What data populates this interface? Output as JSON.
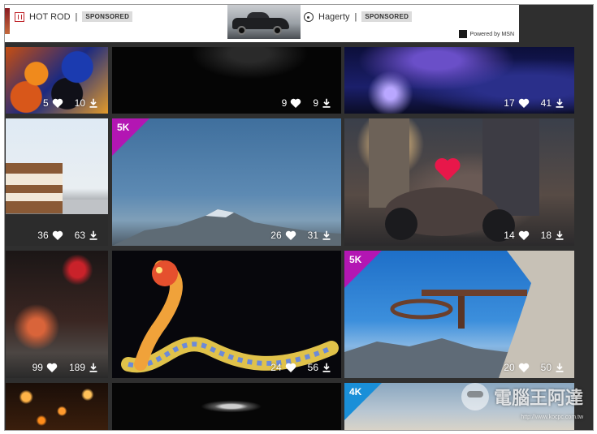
{
  "ads": {
    "ad1": {
      "brand": "HOT ROD",
      "separator": "|",
      "badge": "SPONSORED"
    },
    "ad2": {
      "brand": "Hagerty",
      "separator": "|",
      "badge": "SPONSORED"
    },
    "powered_by": "Powered by MSN"
  },
  "tiles": [
    {
      "likes": "5",
      "downloads": "10"
    },
    {
      "likes": "9",
      "downloads": "9"
    },
    {
      "likes": "17",
      "downloads": "41"
    },
    {
      "likes": "36",
      "downloads": "63"
    },
    {
      "badge": "5K",
      "likes": "26",
      "downloads": "31"
    },
    {
      "likes": "14",
      "downloads": "18"
    },
    {
      "likes": "99",
      "downloads": "189"
    },
    {
      "likes": "24",
      "downloads": "56"
    },
    {
      "badge": "5K",
      "likes": "20",
      "downloads": "50"
    },
    {},
    {},
    {
      "badge": "4K"
    }
  ],
  "watermark": {
    "text": "電腦王阿達",
    "url": "http://www.kocpc.com.tw"
  },
  "colors": {
    "badge_5k": "#b316b3",
    "badge_4k": "#1a8fd8",
    "liked_heart": "#e8174a"
  },
  "icons": {
    "like": "heart-icon",
    "download": "download-icon"
  }
}
